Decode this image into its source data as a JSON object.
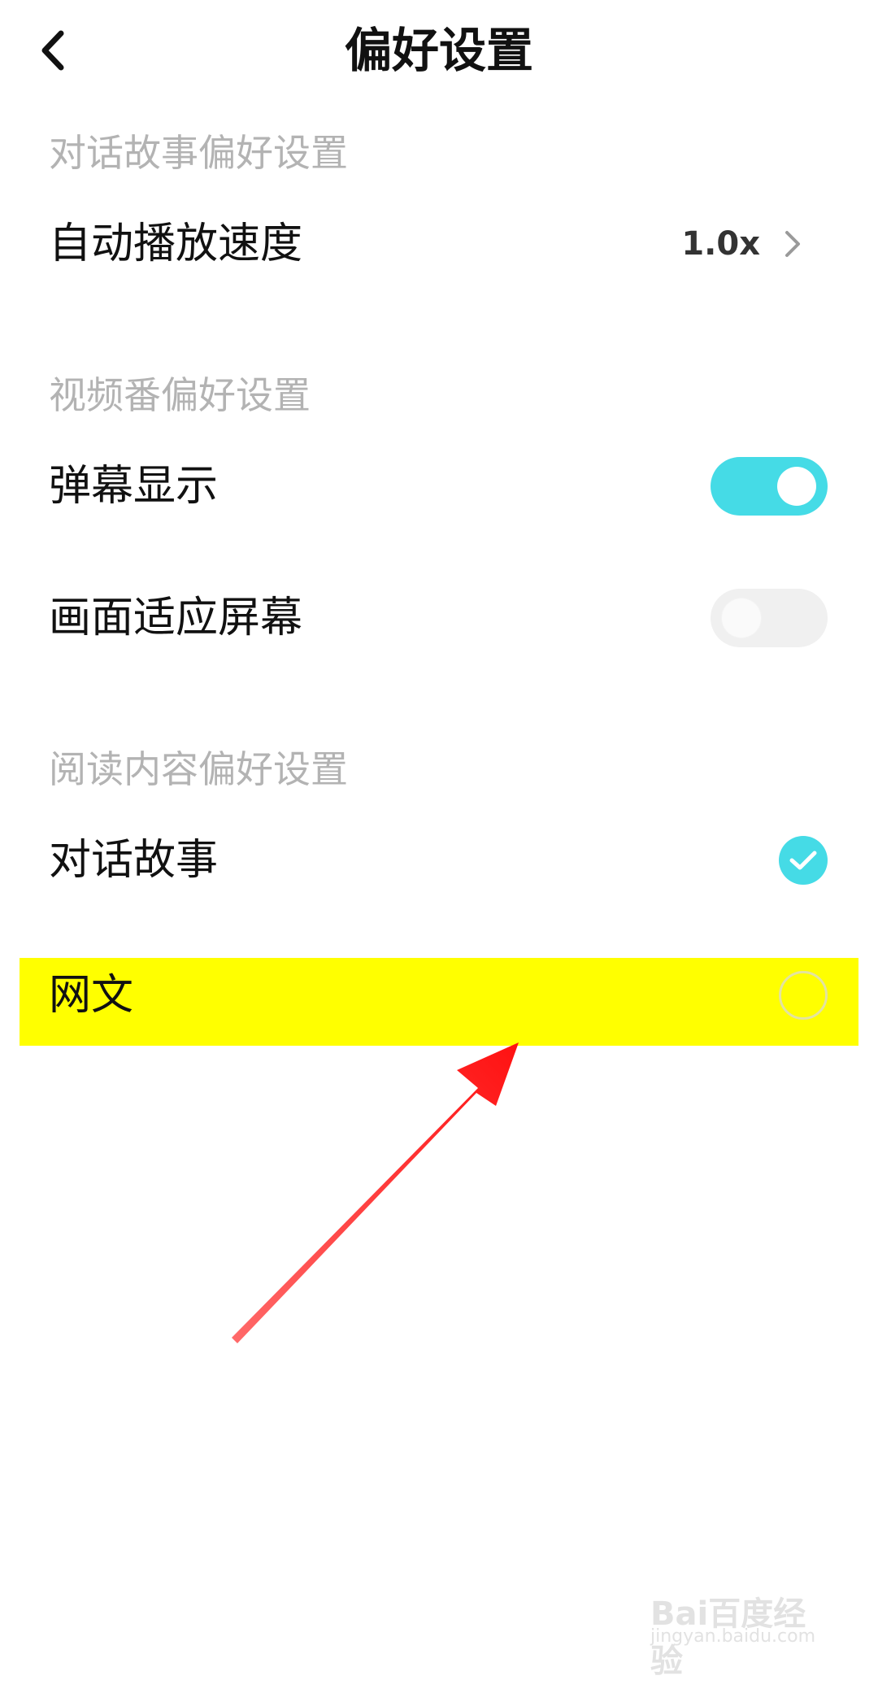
{
  "header": {
    "title": "偏好设置",
    "back_icon": "chevron-left-icon"
  },
  "sections": {
    "dialog": {
      "title": "对话故事偏好设置",
      "autoplay": {
        "label": "自动播放速度",
        "value": "1.0x"
      }
    },
    "video": {
      "title": "视频番偏好设置",
      "danmaku": {
        "label": "弹幕显示",
        "enabled": true
      },
      "fit_screen": {
        "label": "画面适应屏幕",
        "enabled": false
      }
    },
    "reading": {
      "title": "阅读内容偏好设置",
      "dialog_story": {
        "label": "对话故事",
        "checked": true
      },
      "web_novel": {
        "label": "网文",
        "checked": false
      }
    }
  },
  "colors": {
    "accent": "#45dbe6",
    "highlight": "#ffff00",
    "annotation": "#ff1a1a"
  },
  "watermark": {
    "brand": "Bai百度经验",
    "url": "jingyan.baidu.com"
  }
}
